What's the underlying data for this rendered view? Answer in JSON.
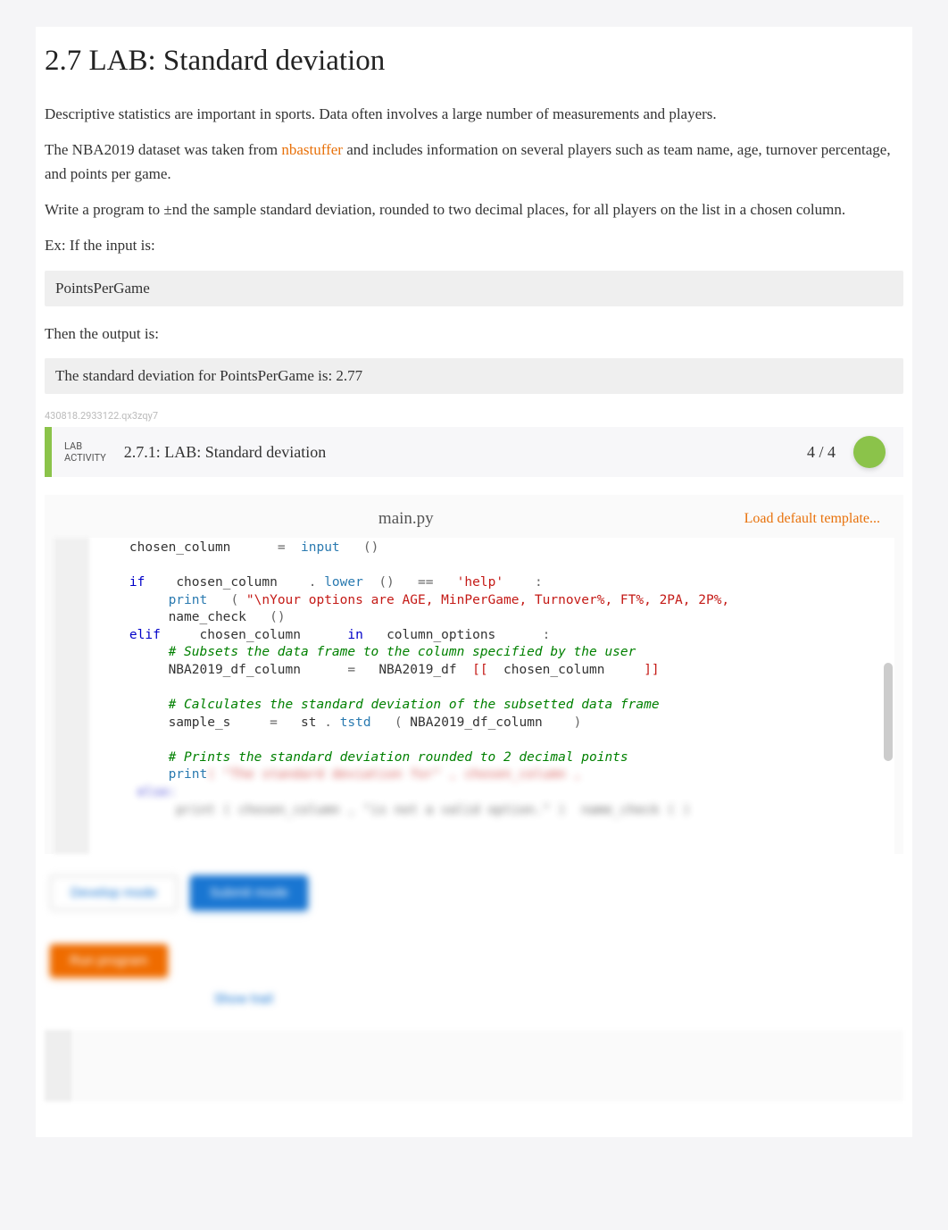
{
  "header": {
    "title": "2.7 LAB: Standard deviation"
  },
  "intro": {
    "p1": "Descriptive statistics are important in sports. Data often involves a large number of measurements and players.",
    "p2a": "The NBA2019 dataset was taken from ",
    "p2link": "nbastuffer",
    "p2b": " and includes information on several players such as team name, age, turnover percentage, and points per game.",
    "p3": "Write a program to ±nd the sample standard deviation, rounded to two decimal places, for all players on the list in a chosen column.",
    "ex_label": "Ex: If the input is:",
    "ex_input": "PointsPerGame",
    "then_label": "Then the output is:",
    "ex_output": "The standard deviation for PointsPerGame is: 2.77"
  },
  "meta_id": "430818.2933122.qx3zqy7",
  "lab": {
    "tag_line1": "LAB",
    "tag_line2": "ACTIVITY",
    "title": "2.7.1: LAB: Standard deviation",
    "score": "4 / 4"
  },
  "editor": {
    "filename": "main.py",
    "load_template": "Load default template..."
  },
  "code": {
    "l1_a": "chosen_column",
    "l1_b": "=",
    "l1_c": "input",
    "l1_d": "()",
    "l3_if": "if",
    "l3_a": "chosen_column",
    "l3_b": ".",
    "l3_c": "lower",
    "l3_d": "()",
    "l3_e": "==",
    "l3_f": "'help'",
    "l3_g": ":",
    "l4_a": "print",
    "l4_b": "(",
    "l4_c": "\"\\nYour options are AGE, MinPerGame, Turnover%, FT%, 2PA, 2P%,",
    "l5_a": "name_check",
    "l5_b": "()",
    "l6_a": "elif",
    "l6_b": "chosen_column",
    "l6_c": "in",
    "l6_d": "column_options",
    "l6_e": ":",
    "l7": "# Subsets the data frame to the column specified by the user",
    "l8_a": "NBA2019_df_column",
    "l8_b": "=",
    "l8_c": "NBA2019_df",
    "l8_d": "[[",
    "l8_e": "chosen_column",
    "l8_f": "]]",
    "l10": "# Calculates the standard deviation of the subsetted data frame",
    "l11_a": "sample_s",
    "l11_b": "=",
    "l11_c": "st",
    "l11_d": ".",
    "l11_e": "tstd",
    "l11_f": "(",
    "l11_g": "NBA2019_df_column",
    "l11_h": ")",
    "l13": "# Prints the standard deviation rounded to 2 decimal points",
    "l14_a": "print",
    "l14_blur": "( \"The standard deviation for\" , chosen_column ,",
    "l15_blur": "     else:",
    "l16_blur": "          print ( chosen_column , \"is not a valid option.\" )  name_check ( )"
  },
  "buttons": {
    "develop": "Develop mode",
    "submit": "Submit mode",
    "run": "Run program",
    "trail": "Show trail"
  }
}
